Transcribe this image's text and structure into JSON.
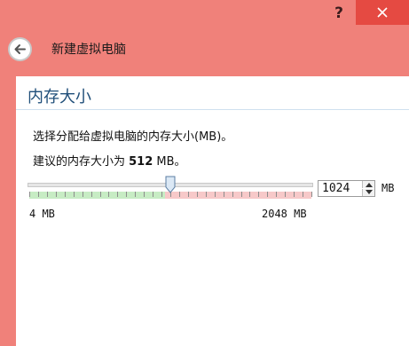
{
  "titlebar": {
    "help_label": "?",
    "close_icon": "close-icon"
  },
  "header": {
    "back_icon": "back-arrow-icon",
    "title": "新建虚拟电脑"
  },
  "section": {
    "title": "内存大小",
    "description": "选择分配给虚拟电脑的内存大小(MB)。",
    "suggest_prefix": "建议的内存大小为 ",
    "suggest_value": "512",
    "suggest_suffix": " MB。"
  },
  "memory": {
    "value": "1024",
    "unit": "MB",
    "min_label": "4 MB",
    "max_label": "2048 MB",
    "min": 4,
    "max": 2048,
    "recommended_range_max": 1024
  },
  "colors": {
    "window_bg": "#f0817a",
    "close_bg": "#e54a42",
    "section_title": "#1f4e79",
    "slider_green": "#c7ecc4",
    "slider_red": "#f7c9c9"
  }
}
